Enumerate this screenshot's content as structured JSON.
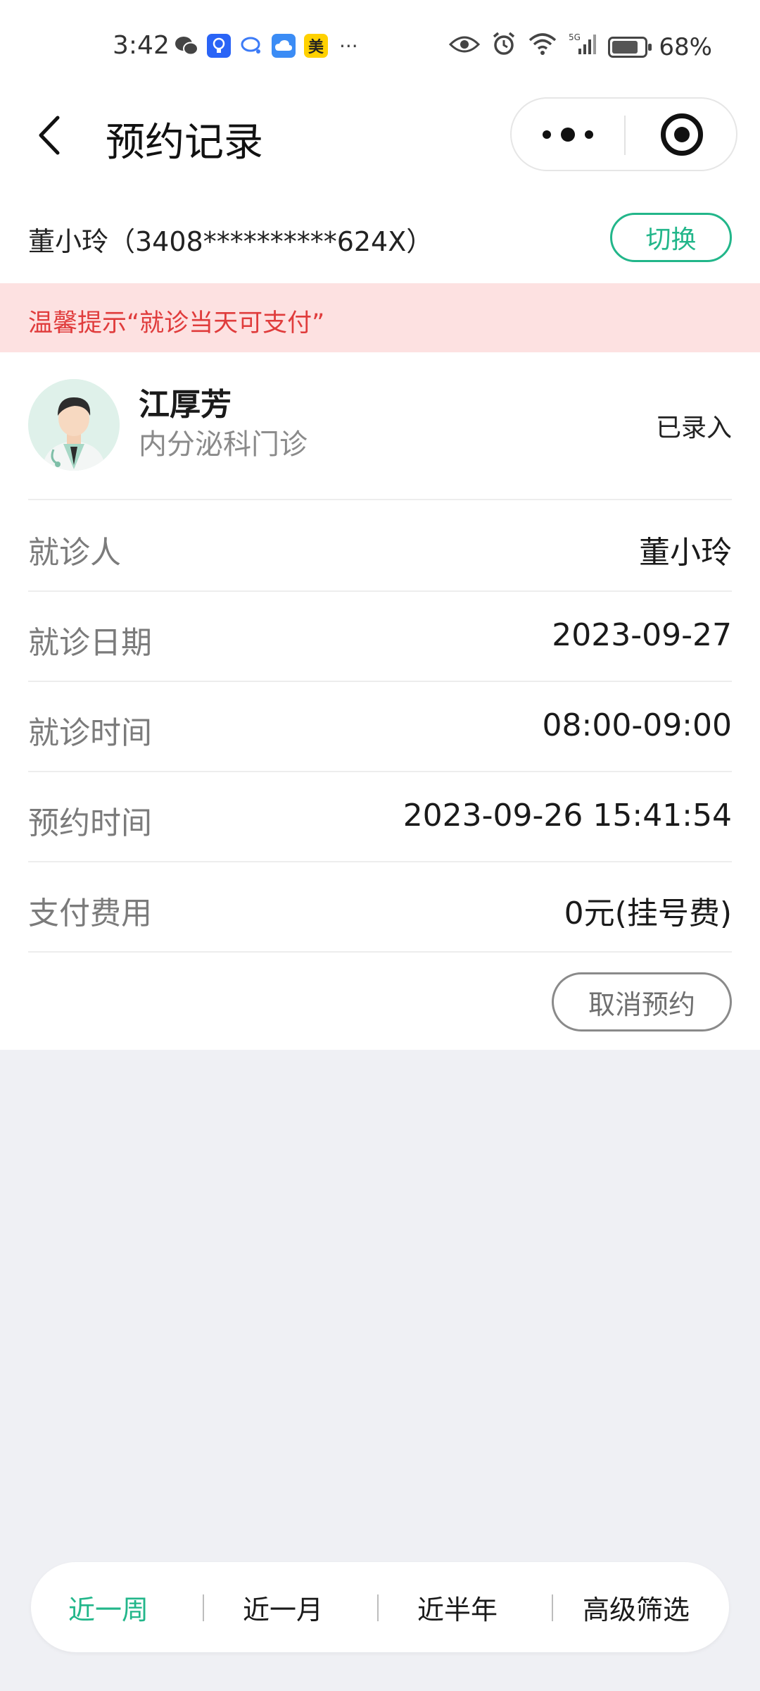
{
  "status_bar": {
    "time": "3:42",
    "left_icons": [
      "wechat-icon",
      "bulb-app-icon",
      "chat-bubble-icon",
      "cloud-app-icon",
      "mei-app-icon"
    ],
    "mei_label": "美",
    "more": "···",
    "battery": "68%"
  },
  "nav": {
    "title": "预约记录"
  },
  "patient": {
    "info": "董小玲（3408**********624X）",
    "switch_label": "切换"
  },
  "notice": {
    "text": "温馨提示“就诊当天可支付”",
    "color": "#e03c3c"
  },
  "record": {
    "doctor_name": "江厚芳",
    "department": "内分泌科门诊",
    "status": "已录入",
    "rows": [
      {
        "label": "就诊人",
        "value": "董小玲"
      },
      {
        "label": "就诊日期",
        "value": "2023-09-27"
      },
      {
        "label": "就诊时间",
        "value": "08:00-09:00"
      },
      {
        "label": "预约时间",
        "value": "2023-09-26 15:41:54"
      },
      {
        "label": "支付费用",
        "value": "0元(挂号费)"
      }
    ],
    "cancel_label": "取消预约"
  },
  "filters": {
    "tabs": [
      {
        "label": "近一周",
        "active": true
      },
      {
        "label": "近一月",
        "active": false
      },
      {
        "label": "近半年",
        "active": false
      },
      {
        "label": "高级筛选",
        "active": false
      }
    ]
  },
  "colors": {
    "accent": "#22b68a",
    "notice_bg": "#fde1e1",
    "page_bg": "#eff0f4"
  }
}
